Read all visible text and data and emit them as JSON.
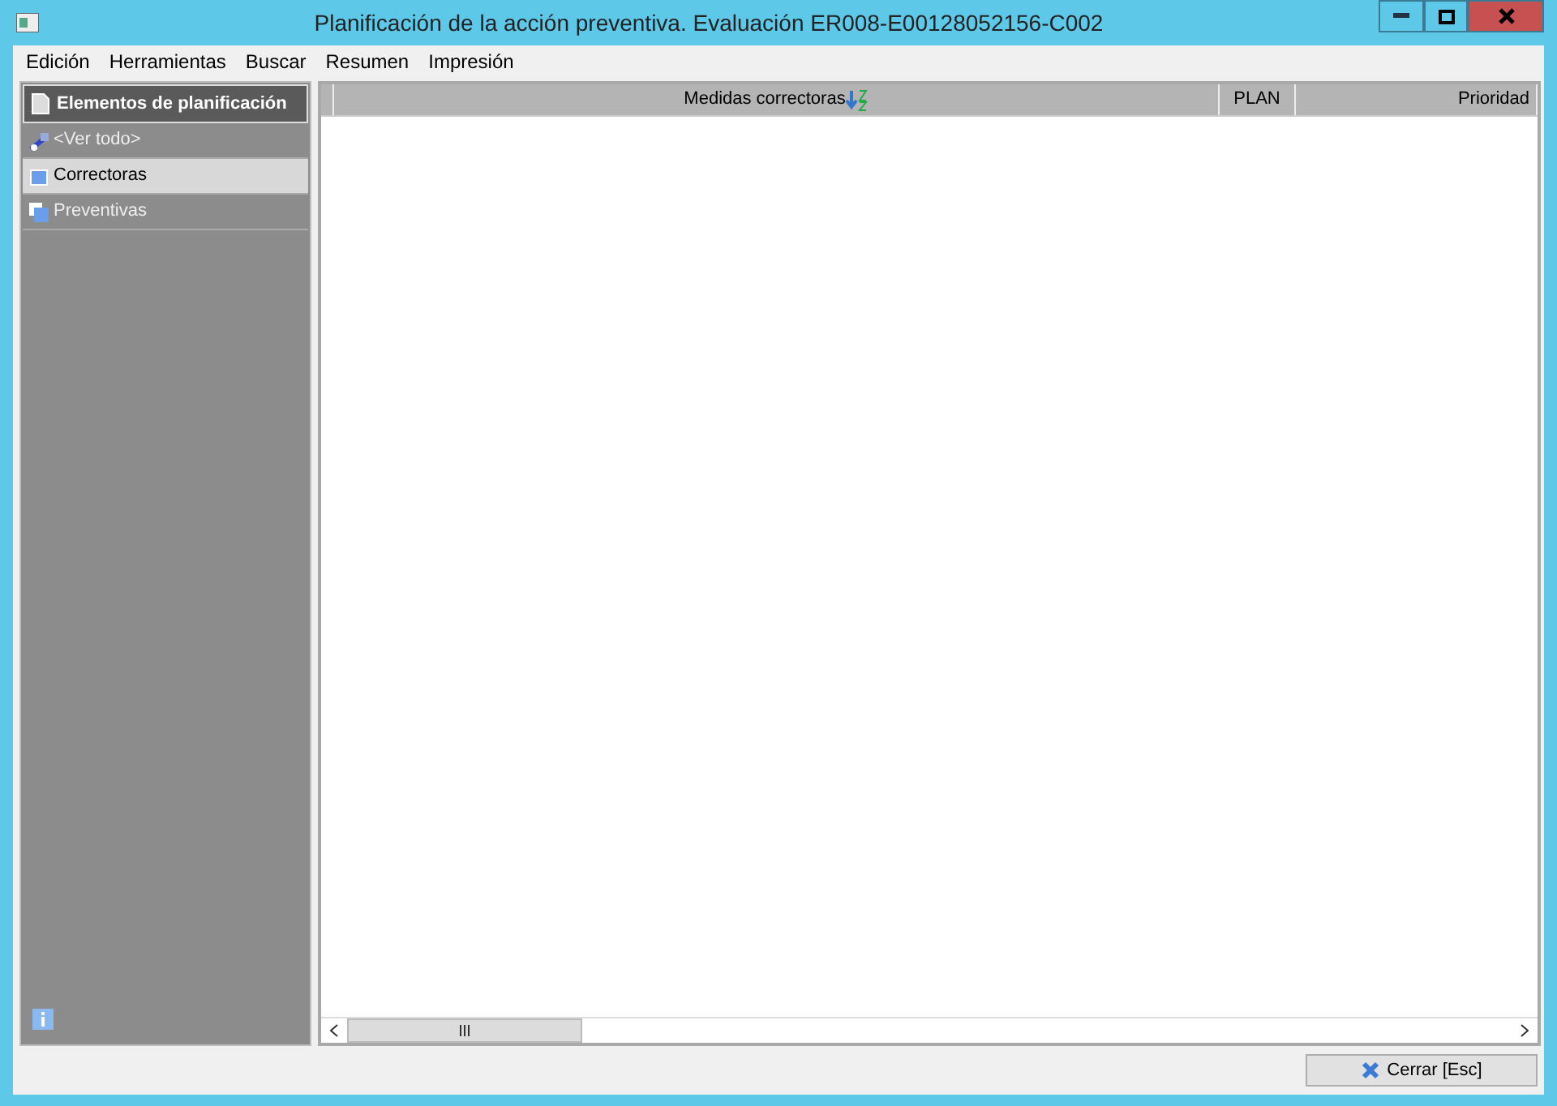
{
  "window": {
    "title": "Planificación de la acción preventiva. Evaluación ER008-E00128052156-C002"
  },
  "menu": [
    "Edición",
    "Herramientas",
    "Buscar",
    "Resumen",
    "Impresión"
  ],
  "sidebar": {
    "header": "Elementos de planificación",
    "items": [
      {
        "label": "<Ver todo>",
        "kind": "all",
        "selected": false
      },
      {
        "label": "Correctoras",
        "kind": "single",
        "selected": true
      },
      {
        "label": "Preventivas",
        "kind": "multi",
        "selected": false
      }
    ]
  },
  "table": {
    "columns": [
      {
        "label": "Medidas correctoras",
        "sorted": true
      },
      {
        "label": "PLAN",
        "sorted": false
      },
      {
        "label": "Prioridad",
        "sorted": false
      }
    ]
  },
  "buttons": [
    {
      "label": "Cerrar [Esc]"
    }
  ]
}
